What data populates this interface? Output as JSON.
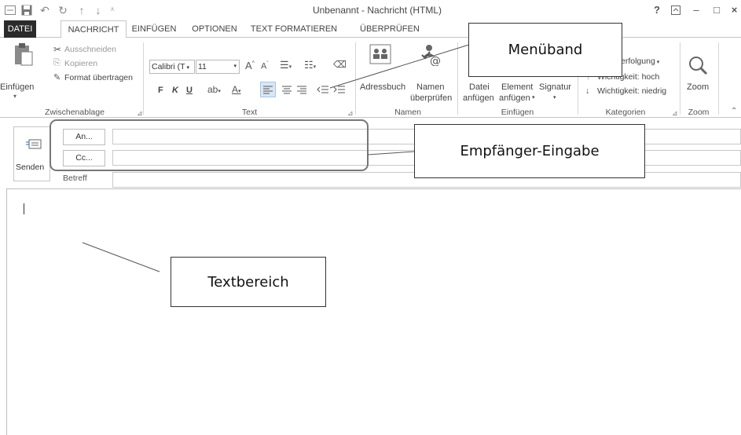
{
  "window": {
    "title": "Unbenannt - Nachricht (HTML)",
    "controls": [
      "?",
      "↑",
      "–",
      "□",
      "×"
    ]
  },
  "quick_access": {
    "icons": [
      "message-icon",
      "save-icon",
      "undo-icon",
      "redo-icon",
      "up-icon",
      "down-icon",
      "customize-icon"
    ]
  },
  "tabs": [
    {
      "label": "DATEI"
    },
    {
      "label": "NACHRICHT"
    },
    {
      "label": "EINFÜGEN"
    },
    {
      "label": "OPTIONEN"
    },
    {
      "label": "TEXT FORMATIEREN"
    },
    {
      "label": "ÜBERPRÜFEN"
    }
  ],
  "ribbon": {
    "clipboard": {
      "paste": "Einfügen",
      "cut": "Ausschneiden",
      "copy": "Kopieren",
      "format_painter": "Format übertragen",
      "label": "Zwischenablage"
    },
    "text": {
      "font": "Calibri (T",
      "size": "11",
      "bold": "F",
      "italic": "K",
      "underline": "U",
      "label": "Text"
    },
    "names": {
      "address_book": "Adressbuch",
      "check_names_1": "Namen",
      "check_names_2": "überprüfen",
      "label": "Namen"
    },
    "insert": {
      "attach_file_1": "Datei",
      "attach_file_2": "anfügen",
      "attach_item_1": "Element",
      "attach_item_2": "anfügen",
      "signature": "Signatur",
      "label": "Einfügen"
    },
    "tags": {
      "follow_up": "erfolgung",
      "high_importance": "Wichtigkeit: hoch",
      "low_importance": "Wichtigkeit: niedrig",
      "label": "Kategorien"
    },
    "zoom": {
      "zoom": "Zoom",
      "label": "Zoom"
    }
  },
  "compose": {
    "send": "Senden",
    "to": "An...",
    "cc": "Cc...",
    "subject_label": "Betreff",
    "to_value": "",
    "cc_value": "",
    "subject_value": ""
  },
  "callouts": {
    "ribbon": "Menüband",
    "recipients": "Empfänger-Eingabe",
    "body": "Textbereich"
  }
}
